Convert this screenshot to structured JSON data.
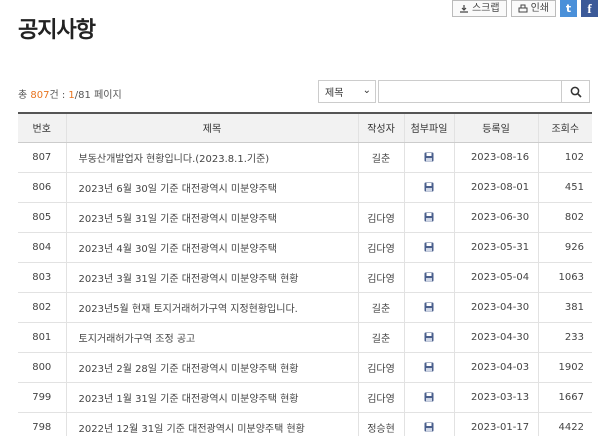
{
  "page": {
    "title": "공지사항"
  },
  "toolbar": {
    "scrap_label": "스크랩",
    "print_label": "인쇄",
    "twitter_glyph": "t",
    "facebook_glyph": "f"
  },
  "summary": {
    "total_prefix": "총 ",
    "total_count": "807",
    "total_unit": "건 : ",
    "current_page": "1",
    "page_sep": "/81",
    "page_unit": " 페이지"
  },
  "search": {
    "field_selected": "제목",
    "query_value": ""
  },
  "colors": {
    "accent": "#e8741f",
    "header_bg": "#f2f2f2",
    "attach_icon": "#4a5f8c"
  },
  "table": {
    "headers": [
      "번호",
      "제목",
      "작성자",
      "첨부파일",
      "등록일",
      "조회수"
    ],
    "rows": [
      {
        "no": "807",
        "subject": "부동산개발업자 현황입니다.(2023.8.1.기준)",
        "author": "길춘",
        "attach": true,
        "date": "2023-08-16",
        "views": "102"
      },
      {
        "no": "806",
        "subject": "2023년 6월 30일 기준 대전광역시 미분양주택",
        "author": "",
        "attach": true,
        "date": "2023-08-01",
        "views": "451"
      },
      {
        "no": "805",
        "subject": "2023년 5월 31일 기준 대전광역시 미분양주택",
        "author": "김다영",
        "attach": true,
        "date": "2023-06-30",
        "views": "802"
      },
      {
        "no": "804",
        "subject": "2023년 4월 30일 기준 대전광역시 미분양주택",
        "author": "김다영",
        "attach": true,
        "date": "2023-05-31",
        "views": "926"
      },
      {
        "no": "803",
        "subject": "2023년 3월 31일 기준 대전광역시 미분양주택 현황",
        "author": "김다영",
        "attach": true,
        "date": "2023-05-04",
        "views": "1063"
      },
      {
        "no": "802",
        "subject": "2023년5월 현재 토지거래허가구역 지정현황입니다.",
        "author": "길춘",
        "attach": true,
        "date": "2023-04-30",
        "views": "381"
      },
      {
        "no": "801",
        "subject": "토지거래허가구역 조정 공고",
        "author": "길춘",
        "attach": true,
        "date": "2023-04-30",
        "views": "233"
      },
      {
        "no": "800",
        "subject": "2023년 2월 28일 기준 대전광역시 미분양주택 현황",
        "author": "김다영",
        "attach": true,
        "date": "2023-04-03",
        "views": "1902"
      },
      {
        "no": "799",
        "subject": "2023년 1월 31일 기준 대전광역시 미분양주택 현황",
        "author": "김다영",
        "attach": true,
        "date": "2023-03-13",
        "views": "1667"
      },
      {
        "no": "798",
        "subject": "2022년 12월 31일 기준 대전광역시 미분양주택 현황",
        "author": "정승현",
        "attach": true,
        "date": "2023-01-17",
        "views": "4422"
      }
    ]
  }
}
